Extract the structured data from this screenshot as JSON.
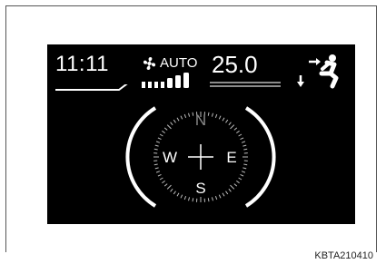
{
  "display": {
    "clock": "11:11",
    "fan_mode": "AUTO",
    "fan_level": 0.8,
    "temperature": "25.0",
    "icons": [
      "fan-icon",
      "airflow-feet-icon",
      "compass-icon"
    ]
  },
  "compass": {
    "north": "N",
    "south": "S",
    "east": "E",
    "west": "W"
  },
  "caption": "KBTA210410",
  "colors": {
    "screen": "#000000",
    "text": "#ffffff",
    "dim": "#8c8c8c"
  }
}
